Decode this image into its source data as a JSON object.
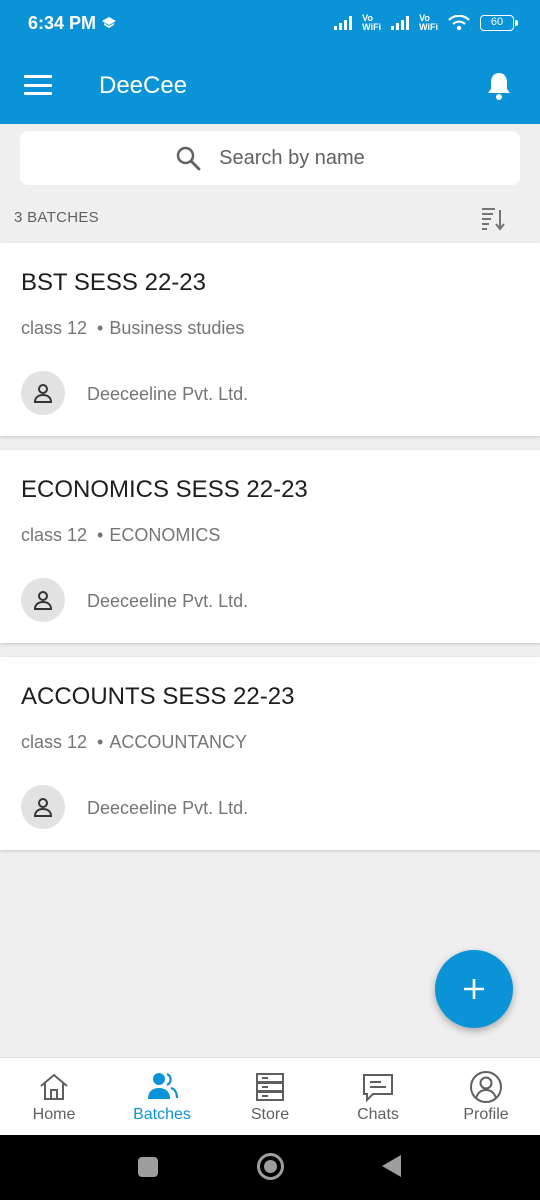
{
  "status_bar": {
    "time": "6:34 PM",
    "vowifi_top": "Vo",
    "vowifi_bottom": "WiFi",
    "battery": "60"
  },
  "app_bar": {
    "title": "DeeCee"
  },
  "search": {
    "placeholder": "Search by name"
  },
  "list_header": {
    "count_label": "3 BATCHES"
  },
  "batches": [
    {
      "title": "BST SESS 22-23",
      "class_label": "class 12",
      "subject": "Business studies",
      "owner": "Deeceeline Pvt. Ltd."
    },
    {
      "title": "ECONOMICS SESS 22-23",
      "class_label": "class 12",
      "subject": "ECONOMICS",
      "owner": "Deeceeline Pvt. Ltd."
    },
    {
      "title": "ACCOUNTS SESS 22-23",
      "class_label": "class 12",
      "subject": "ACCOUNTANCY",
      "owner": "Deeceeline Pvt. Ltd."
    }
  ],
  "bottom_nav": {
    "items": [
      {
        "label": "Home",
        "icon": "home-icon"
      },
      {
        "label": "Batches",
        "icon": "batches-icon",
        "active": true
      },
      {
        "label": "Store",
        "icon": "store-icon"
      },
      {
        "label": "Chats",
        "icon": "chat-icon"
      },
      {
        "label": "Profile",
        "icon": "profile-icon"
      }
    ]
  },
  "colors": {
    "primary": "#0b93d8",
    "background": "#efefef"
  }
}
